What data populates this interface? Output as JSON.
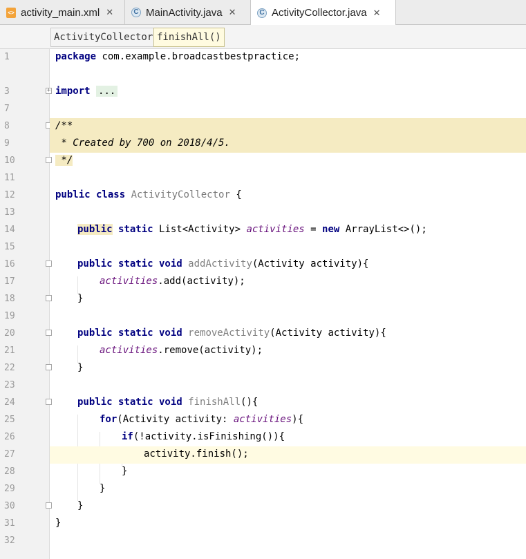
{
  "tabs": [
    {
      "label": "activity_main.xml",
      "icon": "xml-file-icon",
      "active": false
    },
    {
      "label": "MainActivity.java",
      "icon": "java-class-icon",
      "active": false
    },
    {
      "label": "ActivityCollector.java",
      "icon": "java-class-icon",
      "active": true
    }
  ],
  "tab_close": "✕",
  "breadcrumbs": [
    "ActivityCollector",
    "finishAll()"
  ],
  "line_numbers": [
    "1",
    "3",
    "7",
    "8",
    "9",
    "10",
    "11",
    "12",
    "13",
    "14",
    "15",
    "16",
    "17",
    "18",
    "19",
    "20",
    "21",
    "22",
    "23",
    "24",
    "25",
    "26",
    "27",
    "28",
    "29",
    "30",
    "31",
    "32"
  ],
  "code": {
    "l1": {
      "kw": "package",
      "rest": " com.example.broadcastbestpractice;"
    },
    "l3": {
      "kw": "import",
      "folded": "..."
    },
    "l8": "/**",
    "l9": " * Created by 700 on 2018/4/5.",
    "l10": " */",
    "l12": {
      "kw": "public class",
      "name": "ActivityCollector",
      "rest": " {"
    },
    "l14": {
      "kw1": "public",
      "kw2": " static",
      "type": " List<Activity> ",
      "field": "activities",
      "eq": " = ",
      "kw3": "new",
      "rest": " ArrayList<>();"
    },
    "l16": {
      "kw": "public static void",
      "name": "addActivity",
      "rest": "(Activity activity){"
    },
    "l17": {
      "field": "activities",
      "rest": ".add(activity);"
    },
    "l18": "}",
    "l20": {
      "kw": "public static void",
      "name": "removeActivity",
      "rest": "(Activity activity){"
    },
    "l21": {
      "field": "activities",
      "rest": ".remove(activity);"
    },
    "l22": "}",
    "l24": {
      "kw": "public static void",
      "name": "finishAll",
      "rest": "(){"
    },
    "l25": {
      "kw": "for",
      "pre": "(Activity activity: ",
      "field": "activities",
      "rest": "){"
    },
    "l26": {
      "kw": "if",
      "rest": "(!activity.isFinishing()){"
    },
    "l27": "activity.finish();",
    "l28": "}",
    "l29": "}",
    "l30": "}",
    "l31": "}"
  },
  "colors": {
    "keyword": "#000080",
    "field": "#660e7a",
    "comment": "#808080",
    "doc_highlight": "#f5ebc2",
    "current_line": "#fffbe2"
  }
}
